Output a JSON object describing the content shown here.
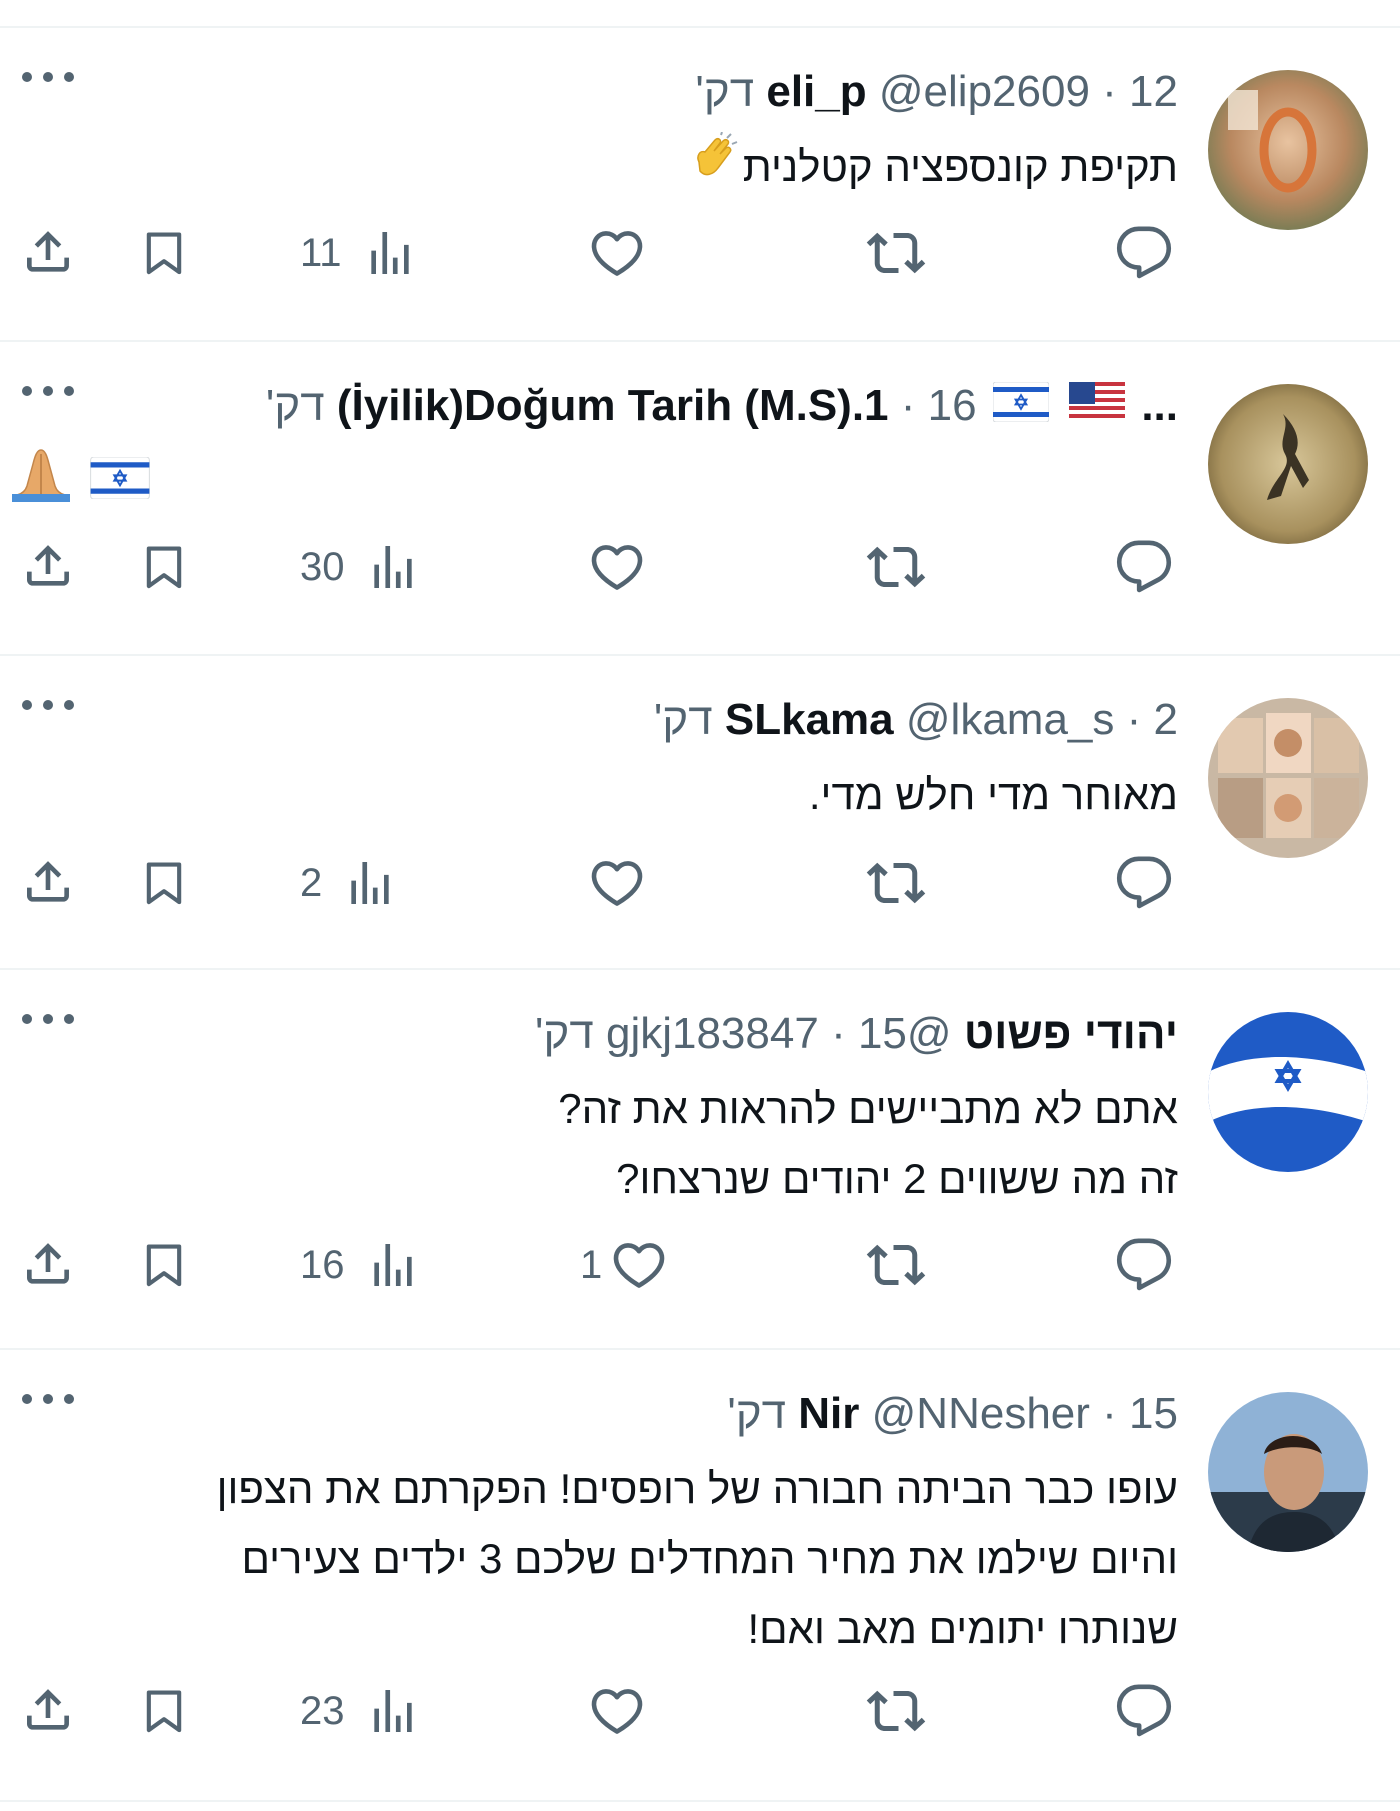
{
  "colors": {
    "text": "#0f1419",
    "secondary": "#536471",
    "divider": "#eff3f4"
  },
  "icons": [
    "more-icon",
    "reply-icon",
    "retweet-icon",
    "like-icon",
    "views-icon",
    "bookmark-icon",
    "share-icon",
    "clapping-hands-emoji",
    "israel-flag-emoji",
    "us-flag-emoji",
    "folded-hands-emoji"
  ],
  "tweets": [
    {
      "name": "eli_p",
      "handle": "@elip2609",
      "dot": "·",
      "time": "12 דק'",
      "text_lines": [
        "תקיפת קונספציה קטלנית"
      ],
      "stats": {
        "replies": "",
        "retweets": "",
        "likes": "",
        "views": "11"
      }
    },
    {
      "name": "...",
      "name_suffix": "(İyilik)Doğum Tarih (M.S).1",
      "handle": "",
      "dot": "·",
      "time": "16 דק'",
      "text_lines": [],
      "stats": {
        "replies": "",
        "retweets": "",
        "likes": "",
        "views": "30"
      }
    },
    {
      "name": "SLkama",
      "handle": "@lkama_s",
      "dot": "·",
      "time": "2 דק'",
      "text_lines": [
        "מאוחר מדי חלש מדי."
      ],
      "stats": {
        "replies": "",
        "retweets": "",
        "likes": "",
        "views": "2"
      }
    },
    {
      "name": "יהודי פשוט",
      "handle": "@gjkj183847",
      "dot": "·",
      "time": "15 דק'",
      "text_lines": [
        "אתם לא מתביישים להראות את זה?",
        "זה מה ששווים 2 יהודים שנרצחו?"
      ],
      "stats": {
        "replies": "",
        "retweets": "",
        "likes": "1",
        "views": "16"
      }
    },
    {
      "name": "Nir",
      "handle": "@NNesher",
      "dot": "·",
      "time": "15 דק'",
      "text_lines": [
        "עופו כבר הביתה חבורה של רופסים! הפקרתם את הצפון",
        "והיום שילמו את מחיר המחדלים שלכם 3 ילדים צעירים",
        "שנותרו יתומים מאב ואם!"
      ],
      "stats": {
        "replies": "",
        "retweets": "",
        "likes": "",
        "views": "23"
      }
    }
  ]
}
